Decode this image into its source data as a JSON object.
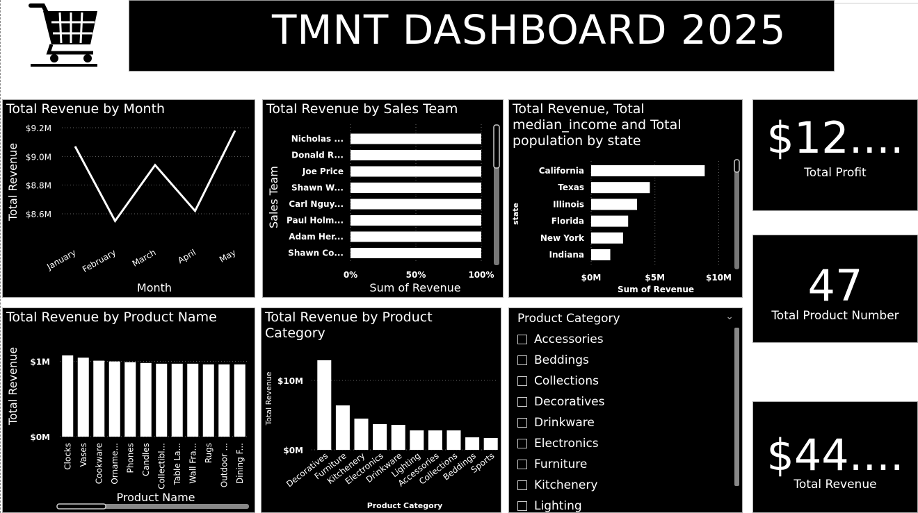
{
  "header": {
    "title": "TMNT DASHBOARD 2025",
    "logo_icon": "shopping-cart-icon"
  },
  "colors": {
    "panel_bg": "#000000",
    "mark": "#ffffff",
    "page_bg": "#ffffff"
  },
  "charts": {
    "month": {
      "title": "Total Revenue by Month",
      "xlabel": "Month",
      "ylabel": "Total Revenue",
      "y_ticks": [
        "$9.2M",
        "$9.0M",
        "$8.8M",
        "$8.6M"
      ]
    },
    "sales_team": {
      "title": "Total Revenue by Sales Team",
      "xlabel": "Sum of Revenue",
      "ylabel": "Sales Team",
      "x_ticks": [
        "0%",
        "50%",
        "100%"
      ]
    },
    "state": {
      "title": "Total Revenue, Total median_income and Total population by state",
      "xlabel": "Sum of Revenue",
      "ylabel": "state",
      "x_ticks": [
        "$0M",
        "$5M",
        "$10M"
      ]
    },
    "product_name": {
      "title": "Total Revenue by Product Name",
      "xlabel": "Product Name",
      "ylabel": "Total Revenue",
      "y_ticks": [
        "$1M",
        "$0M"
      ]
    },
    "product_category": {
      "title": "Total Revenue by Product Category",
      "xlabel": "Product Category",
      "ylabel": "Total Revenue",
      "y_ticks": [
        "$10M",
        "$0M"
      ]
    }
  },
  "chart_data": [
    {
      "type": "line",
      "title": "Total Revenue by Month",
      "xlabel": "Month",
      "ylabel": "Total Revenue",
      "categories": [
        "January",
        "February",
        "March",
        "April",
        "May"
      ],
      "values": [
        9.07,
        8.55,
        8.94,
        8.62,
        9.18
      ],
      "unit": "$M",
      "ylim": [
        8.45,
        9.2
      ],
      "grid": true
    },
    {
      "type": "bar",
      "orientation": "horizontal",
      "title": "Total Revenue by Sales Team",
      "xlabel": "Sum of Revenue",
      "ylabel": "Sales Team",
      "categories": [
        "Nicholas ...",
        "Donald R...",
        "Joe Price",
        "Shawn W...",
        "Carl Nguy...",
        "Paul Holm...",
        "Adam Her...",
        "Shawn Co..."
      ],
      "values": [
        100,
        100,
        100,
        100,
        100,
        100,
        100,
        100
      ],
      "unit": "%",
      "xlim": [
        0,
        100
      ]
    },
    {
      "type": "bar",
      "orientation": "horizontal",
      "title": "Total Revenue, Total median_income and Total population by state",
      "xlabel": "Sum of Revenue",
      "ylabel": "state",
      "categories": [
        "California",
        "Texas",
        "Illinois",
        "Florida",
        "New York",
        "Indiana"
      ],
      "values": [
        8.9,
        4.6,
        3.6,
        2.9,
        2.5,
        1.5
      ],
      "unit": "$M",
      "xlim": [
        0,
        10.9
      ]
    },
    {
      "type": "bar",
      "title": "Total Revenue by Product Name",
      "xlabel": "Product Name",
      "ylabel": "Total Revenue",
      "categories": [
        "Clocks",
        "Vases",
        "Cookware",
        "Orname...",
        "Phones",
        "Candles",
        "Collectibl...",
        "Table La...",
        "Wall Fra...",
        "Rugs",
        "Outdoor ...",
        "Dining F..."
      ],
      "values": [
        1.08,
        1.05,
        1.01,
        1.0,
        0.99,
        0.98,
        0.97,
        0.97,
        0.97,
        0.96,
        0.96,
        0.96
      ],
      "unit": "$M",
      "ylim": [
        0,
        1.2
      ]
    },
    {
      "type": "bar",
      "title": "Total Revenue by Product Category",
      "xlabel": "Product Category",
      "ylabel": "Total Revenue",
      "categories": [
        "Decoratives",
        "Furniture",
        "Kitchenery",
        "Electronics",
        "Drinkware",
        "Lighting",
        "Accessories",
        "Collections",
        "Beddings",
        "Sports"
      ],
      "values": [
        12.9,
        6.4,
        4.5,
        3.7,
        3.6,
        2.8,
        2.8,
        2.8,
        1.8,
        1.7
      ],
      "unit": "$M",
      "ylim": [
        0,
        13.9
      ]
    }
  ],
  "kpis": [
    {
      "value": "$12....",
      "label": "Total Profit"
    },
    {
      "value": "47",
      "label": "Total Product Number"
    },
    {
      "value": "$44....",
      "label": "Total Revenue"
    }
  ],
  "slicer": {
    "title": "Product Category",
    "chevron_icon": "chevron-down-icon",
    "items": [
      "Accessories",
      "Beddings",
      "Collections",
      "Decoratives",
      "Drinkware",
      "Electronics",
      "Furniture",
      "Kitchenery",
      "Lighting"
    ]
  }
}
